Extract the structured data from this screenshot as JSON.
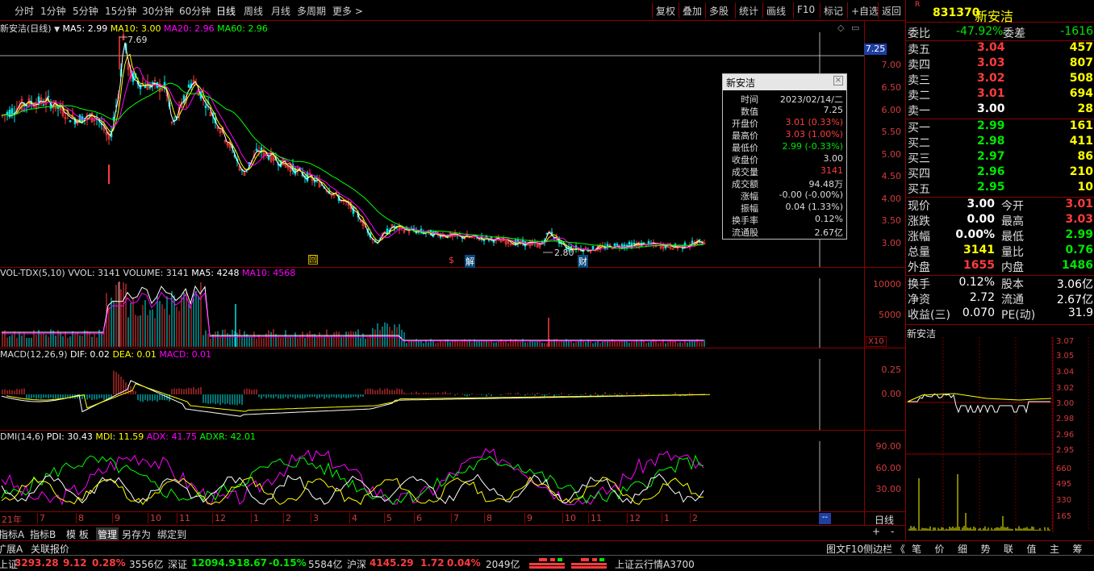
{
  "colors": {
    "up": "#ff3c3c",
    "down": "#00e600",
    "ma5": "#ffffff",
    "ma10": "#ffff00",
    "ma20": "#ff00ff",
    "ma60": "#00ff00",
    "frame": "#8b0000",
    "axis": "#d23c3c"
  },
  "topbar": {
    "periods": [
      "分时",
      "1分钟",
      "5分钟",
      "15分钟",
      "30分钟",
      "60分钟",
      "日线",
      "周线",
      "月线",
      "多周期",
      "更多 >"
    ],
    "active": "日线",
    "right_buttons": [
      "复权",
      "叠加",
      "多股",
      "统计",
      "画线",
      "F10",
      "标记",
      "+自选",
      "返回"
    ]
  },
  "main_chart": {
    "legend": {
      "name": "新安洁(日线)",
      "ma5": "MA5: 2.99",
      "ma10": "MA10: 3.00",
      "ma20": "MA20: 2.96",
      "ma60": "MA60: 2.96"
    },
    "high_mark": "7.69",
    "low_mark": "2.80",
    "crosshair_price": "7.25",
    "y_ticks": [
      "7.00",
      "6.50",
      "6.00",
      "5.50",
      "5.00",
      "4.50",
      "4.00",
      "3.50",
      "3.00"
    ],
    "event_marks": [
      "回",
      "$",
      "解",
      "财"
    ]
  },
  "vol_chart": {
    "legend": {
      "name": "VOL-TDX(5,10)",
      "vvol": "VVOL: 3141",
      "volume": "VOLUME: 3141",
      "ma5": "MA5: 4248",
      "ma10": "MA10: 4568"
    },
    "y_ticks": [
      "10000",
      "5000"
    ],
    "unit": "X10"
  },
  "macd_chart": {
    "legend": {
      "name": "MACD(12,26,9)",
      "dif": "DIF: 0.02",
      "dea": "DEA: 0.01",
      "macd": "MACD: 0.01"
    },
    "y_ticks": [
      "0.25",
      "0.00"
    ]
  },
  "dmi_chart": {
    "legend": {
      "name": "DMI(14,6)",
      "pdi": "PDI: 30.43",
      "mdi": "MDI: 11.59",
      "adx": "ADX: 41.75",
      "adxr": "ADXR: 42.01"
    },
    "y_ticks": [
      "90.00",
      "60.00",
      "30.00"
    ]
  },
  "x_axis": {
    "labels": [
      "21年",
      "7",
      "8",
      "9",
      "10",
      "11",
      "12",
      "1",
      "2",
      "3",
      "4",
      "5",
      "6",
      "7",
      "8",
      "9",
      "10",
      "11",
      "12",
      "1",
      "2"
    ],
    "crosshair": "--",
    "period": "日线",
    "plus": "+",
    "minus": "-"
  },
  "tooltip": {
    "title": "新安洁",
    "close": "×",
    "rows": [
      {
        "k": "时间",
        "v": "2023/02/14/二",
        "c": "#dddddd"
      },
      {
        "k": "数值",
        "v": "7.25",
        "c": "#dddddd"
      },
      {
        "k": "开盘价",
        "v": "3.01 (0.33%)",
        "c": "#ff3c3c"
      },
      {
        "k": "最高价",
        "v": "3.03 (1.00%)",
        "c": "#ff3c3c"
      },
      {
        "k": "最低价",
        "v": "2.99 (-0.33%)",
        "c": "#00e600"
      },
      {
        "k": "收盘价",
        "v": "3.00",
        "c": "#dddddd"
      },
      {
        "k": "成交量",
        "v": "3141",
        "c": "#ff3c3c"
      },
      {
        "k": "成交额",
        "v": "94.48万",
        "c": "#dddddd"
      },
      {
        "k": "涨幅",
        "v": "-0.00 (-0.00%)",
        "c": "#dddddd"
      },
      {
        "k": "振幅",
        "v": "0.04 (1.33%)",
        "c": "#dddddd"
      },
      {
        "k": "换手率",
        "v": "0.12%",
        "c": "#dddddd"
      },
      {
        "k": "流通股",
        "v": "2.67亿",
        "c": "#dddddd"
      }
    ]
  },
  "quote": {
    "badge": "R",
    "code": "831370",
    "name": "新安洁",
    "weibi_label": "委比",
    "weibi": "-47.92%",
    "weicha_label": "委差",
    "weicha": "-1616",
    "sells": [
      {
        "l": "卖五",
        "p": "3.04",
        "v": "457"
      },
      {
        "l": "卖四",
        "p": "3.03",
        "v": "807"
      },
      {
        "l": "卖三",
        "p": "3.02",
        "v": "508"
      },
      {
        "l": "卖二",
        "p": "3.01",
        "v": "694"
      },
      {
        "l": "卖一",
        "p": "3.00",
        "v": "28"
      }
    ],
    "buys": [
      {
        "l": "买一",
        "p": "2.99",
        "v": "161"
      },
      {
        "l": "买二",
        "p": "2.98",
        "v": "411"
      },
      {
        "l": "买三",
        "p": "2.97",
        "v": "86"
      },
      {
        "l": "买四",
        "p": "2.96",
        "v": "210"
      },
      {
        "l": "买五",
        "p": "2.95",
        "v": "10"
      }
    ],
    "stats": [
      {
        "a": "现价",
        "av": "3.00",
        "ac": "#ffffff",
        "b": "今开",
        "bv": "3.01",
        "bc": "#ff3c3c"
      },
      {
        "a": "涨跌",
        "av": "0.00",
        "ac": "#ffffff",
        "b": "最高",
        "bv": "3.03",
        "bc": "#ff3c3c"
      },
      {
        "a": "涨幅",
        "av": "0.00%",
        "ac": "#ffffff",
        "b": "最低",
        "bv": "2.99",
        "bc": "#00e600"
      },
      {
        "a": "总量",
        "av": "3141",
        "ac": "#ffff00",
        "b": "量比",
        "bv": "0.76",
        "bc": "#00e600"
      },
      {
        "a": "外盘",
        "av": "1655",
        "ac": "#ff3c3c",
        "b": "内盘",
        "bv": "1486",
        "bc": "#00e600"
      }
    ],
    "stats2": [
      {
        "a": "换手",
        "av": "0.12%",
        "b": "股本",
        "bv": "3.06亿"
      },
      {
        "a": "净资",
        "av": "2.72",
        "b": "流通",
        "bv": "2.67亿"
      },
      {
        "a": "收益(三)",
        "av": "0.070",
        "b": "PE(动)",
        "bv": "31.9"
      }
    ],
    "mini_title": "新安洁",
    "mini_price_ticks": [
      "3.07",
      "3.05",
      "3.04",
      "3.02",
      "3.00",
      "2.98",
      "2.96",
      "2.95"
    ],
    "mini_vol_ticks": [
      "660",
      "495",
      "330",
      "165"
    ]
  },
  "bottom_tabs": [
    "指标A",
    "指标B",
    "模 板",
    "管理",
    "另存为",
    "绑定到"
  ],
  "bar2": {
    "left": [
      "扩展A",
      "关联报价"
    ],
    "right_left": "图文F10",
    "right_mid": "侧边栏 《",
    "right_tabs": [
      "笔",
      "价",
      "细",
      "势",
      "联",
      "值",
      "主",
      "筹"
    ]
  },
  "status": {
    "sh_label": "上证",
    "sh_val": "3293.28",
    "sh_chg": "9.12",
    "sh_pct": "0.28%",
    "sh_amt": "3556亿",
    "sz_label": "深证",
    "sz_val": "12094.9",
    "sz_chg": "-18.67",
    "sz_pct": "-0.15%",
    "sz_amt": "5584亿",
    "hs_label": "沪深",
    "hs_val": "4145.29",
    "hs_chg": "1.72",
    "hs_pct": "0.04%",
    "hs_amt": "2049亿",
    "cloud": "上证云行情A3700"
  }
}
